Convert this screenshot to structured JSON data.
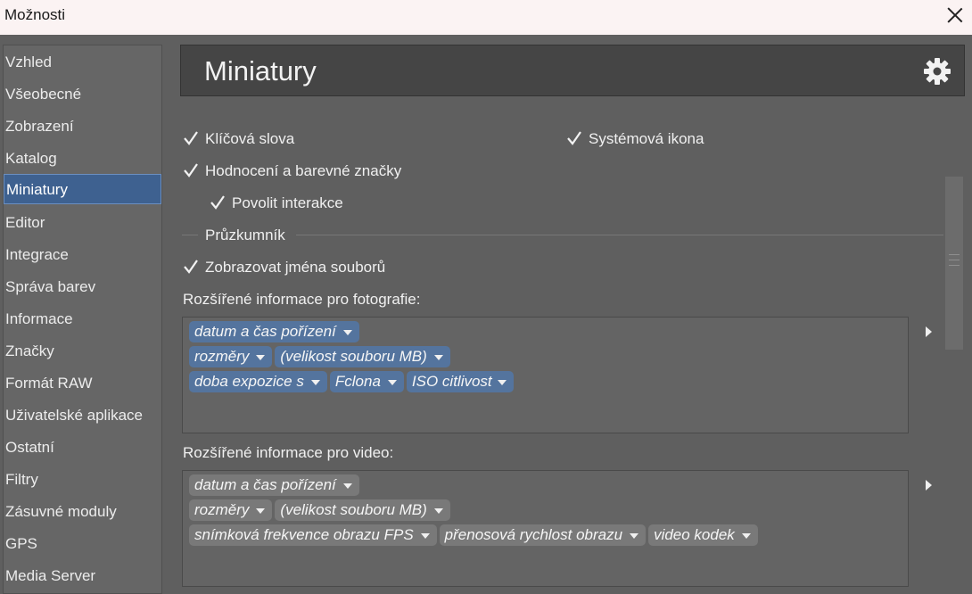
{
  "window": {
    "title": "Možnosti"
  },
  "sidebar": {
    "items": [
      {
        "label": "Vzhled"
      },
      {
        "label": "Všeobecné"
      },
      {
        "label": "Zobrazení"
      },
      {
        "label": "Katalog"
      },
      {
        "label": "Miniatury",
        "active": true
      },
      {
        "label": "Editor"
      },
      {
        "label": "Integrace"
      },
      {
        "label": "Správa barev"
      },
      {
        "label": "Informace"
      },
      {
        "label": "Značky"
      },
      {
        "label": "Formát RAW"
      },
      {
        "label": "Uživatelské aplikace"
      },
      {
        "label": "Ostatní"
      },
      {
        "label": "Filtry"
      },
      {
        "label": "Zásuvné moduly"
      },
      {
        "label": "GPS"
      },
      {
        "label": "Media Server"
      }
    ]
  },
  "header": {
    "title": "Miniatury",
    "icon": "gear-icon"
  },
  "options": {
    "keywords": {
      "label": "Klíčová slova",
      "checked": true
    },
    "system_icon": {
      "label": "Systémová ikona",
      "checked": true
    },
    "rating": {
      "label": "Hodnocení a barevné značky",
      "checked": true
    },
    "interactions": {
      "label": "Povolit interakce",
      "checked": true
    }
  },
  "explorer": {
    "section_label": "Průzkumník",
    "show_filenames": {
      "label": "Zobrazovat jména souborů",
      "checked": true
    }
  },
  "photo_info": {
    "label": "Rozšířené informace pro fotografie:",
    "rows": [
      [
        "datum a čas pořízení"
      ],
      [
        "rozměry",
        "(velikost souboru MB)"
      ],
      [
        "doba expozice s",
        "Fclona",
        "ISO citlivost"
      ]
    ]
  },
  "video_info": {
    "label": "Rozšířené informace pro video:",
    "rows": [
      [
        "datum a čas pořízení"
      ],
      [
        "rozměry",
        "(velikost souboru MB)"
      ],
      [
        "snímková frekvence obrazu FPS",
        "přenosová rychlost obrazu",
        "video kodek"
      ]
    ]
  },
  "colors": {
    "selection": "#3e6190",
    "token_selected": "#54749e",
    "token": "#797979"
  }
}
